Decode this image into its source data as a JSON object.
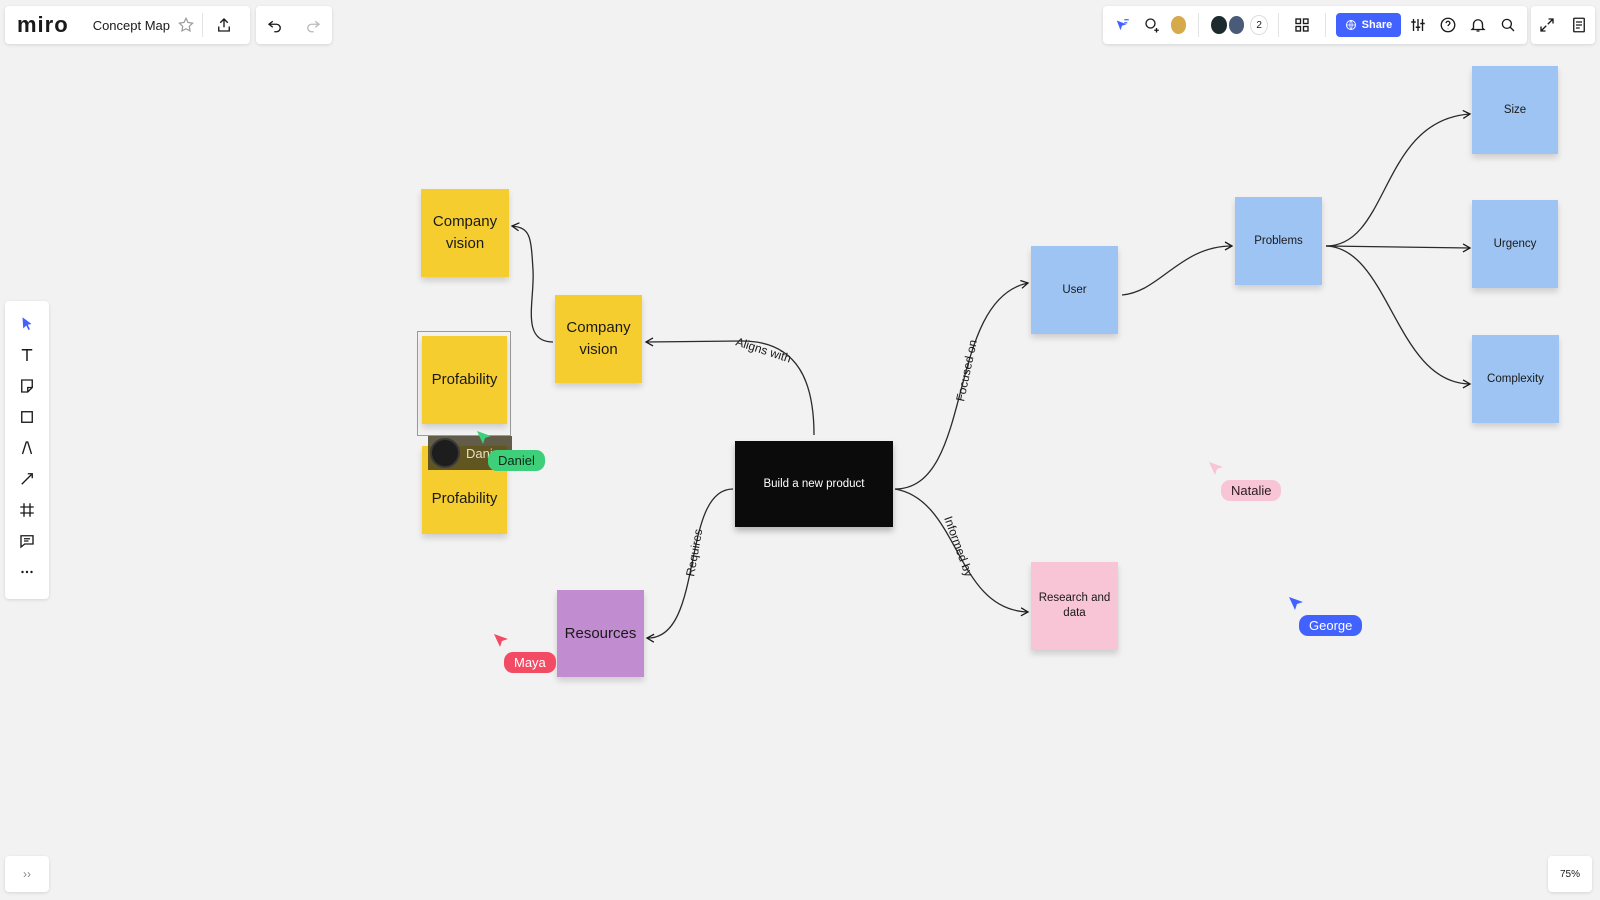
{
  "app": {
    "logo": "miro",
    "board_title": "Concept Map"
  },
  "toolbar_right": {
    "collaborator_count": "2",
    "share_label": "Share"
  },
  "zoom": "75%",
  "notes": {
    "company_vision_top": "Company vision",
    "company_vision_mid": "Company vision",
    "profitability_top": "Profability",
    "profitability_bottom": "Profability",
    "resources": "Resources",
    "center": "Build a new product",
    "user": "User",
    "problems": "Problems",
    "size": "Size",
    "urgency": "Urgency",
    "complexity": "Complexity",
    "research": "Research and data"
  },
  "connectors": {
    "aligns_with": "Aligns with",
    "focused_on": "Focused on",
    "informed_by": "Informed by",
    "requires": "Requires"
  },
  "cursors": {
    "daniel": "Daniel",
    "daniel_partial": "Dani",
    "natalie": "Natalie",
    "george": "George",
    "maya": "Maya"
  },
  "colors": {
    "yellow": "#f6cd2f",
    "blue": "#9dc4f2",
    "pink": "#f7c5d6",
    "purple": "#c28cd1",
    "share": "#4262ff",
    "daniel": "#3dcf7a",
    "natalie": "#f7c5d6",
    "george": "#4262ff",
    "maya": "#f24b63"
  }
}
